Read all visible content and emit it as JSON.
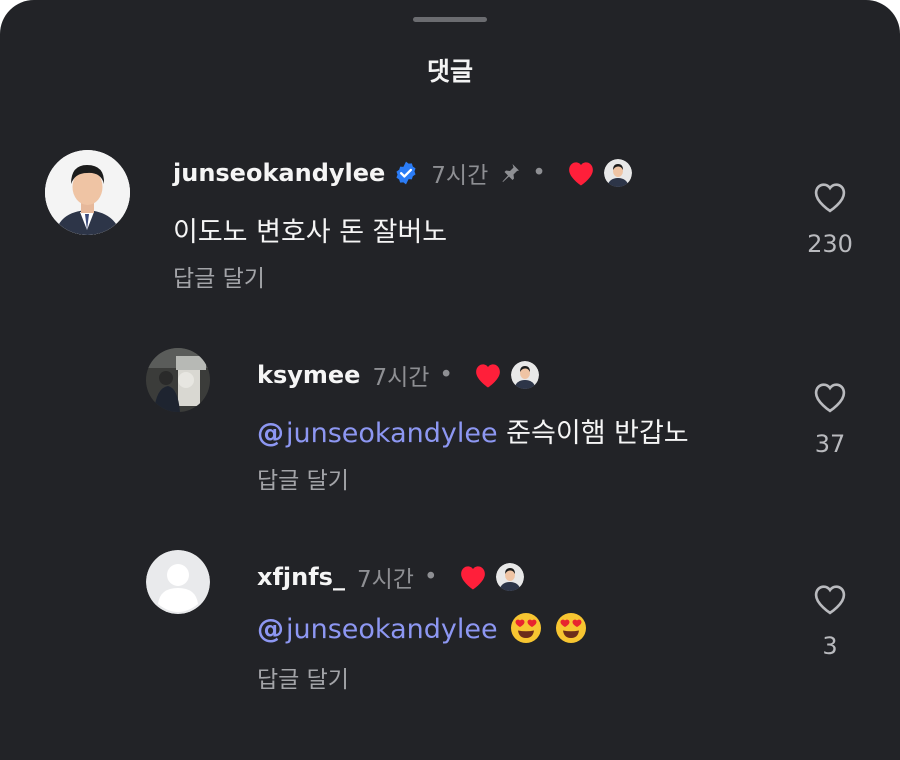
{
  "sheet": {
    "title": "댓글"
  },
  "comments": [
    {
      "username": "junseokandylee",
      "verified": true,
      "time": "7시간",
      "pinned": true,
      "dot": "•",
      "text": "이도노 변호사 돈 잘버노",
      "reply": "답글 달기",
      "likes": "230"
    },
    {
      "username": "ksymee",
      "time": "7시간",
      "dot": "•",
      "mention": "junseokandylee",
      "text": " 준슥이햄 반갑노",
      "reply": "답글 달기",
      "likes": "37"
    },
    {
      "username": "xfjnfs_",
      "time": "7시간",
      "dot": "•",
      "mention": "junseokandylee",
      "text": "",
      "reply": "답글 달기",
      "likes": "3"
    }
  ],
  "colors": {
    "background": "#222327",
    "mention": "#8d97f2",
    "heart": "#ff1f3a",
    "verified": "#2b7cf6"
  },
  "icons": [
    "verified-badge-icon",
    "pin-icon",
    "creator-liked-heart-icon",
    "like-heart-icon",
    "heart-eyes-emoji",
    "threads-mention-icon"
  ]
}
